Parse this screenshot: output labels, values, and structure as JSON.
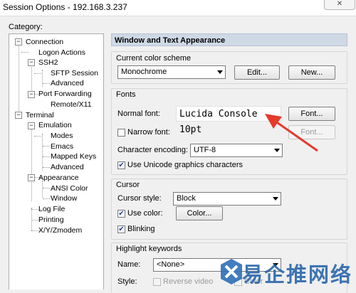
{
  "window": {
    "title": "Session Options - 192.168.3.237",
    "close_glyph": "✕"
  },
  "category_label": "Category:",
  "tree": [
    {
      "label": "Connection",
      "expander": "−"
    },
    {
      "label": "Logon Actions"
    },
    {
      "label": "SSH2",
      "expander": "−"
    },
    {
      "label": "SFTP Session"
    },
    {
      "label": "Advanced"
    },
    {
      "label": "Port Forwarding",
      "expander": "−"
    },
    {
      "label": "Remote/X11"
    },
    {
      "label": "Terminal",
      "expander": "−"
    },
    {
      "label": "Emulation",
      "expander": "−"
    },
    {
      "label": "Modes"
    },
    {
      "label": "Emacs"
    },
    {
      "label": "Mapped Keys"
    },
    {
      "label": "Advanced"
    },
    {
      "label": "Appearance",
      "expander": "−"
    },
    {
      "label": "ANSI Color"
    },
    {
      "label": "Window"
    },
    {
      "label": "Log File"
    },
    {
      "label": "Printing"
    },
    {
      "label": "X/Y/Zmodem"
    }
  ],
  "panel": {
    "header": "Window and Text Appearance",
    "color_scheme": {
      "label": "Current color scheme",
      "value": "Monochrome",
      "edit_button": "Edit...",
      "new_button": "New..."
    },
    "fonts": {
      "label": "Fonts",
      "normal_font_label": "Normal font:",
      "normal_font_value": "Lucida Console 10pt",
      "font_button": "Font...",
      "narrow_font_label": "Narrow font:",
      "narrow_font_button": "Font...",
      "encoding_label": "Character encoding:",
      "encoding_value": "UTF-8",
      "unicode_label": "Use Unicode graphics characters",
      "unicode_checked": "✔"
    },
    "cursor": {
      "label": "Cursor",
      "style_label": "Cursor style:",
      "style_value": "Block",
      "use_color_label": "Use color:",
      "use_color_checked": "✔",
      "color_button": "Color...",
      "blinking_label": "Blinking",
      "blinking_checked": "✔"
    },
    "highlight": {
      "label": "Highlight keywords",
      "name_label": "Name:",
      "name_value": "<None>",
      "style_label": "Style:",
      "reverse_video_label": "Reverse video",
      "color_label": "Color"
    }
  },
  "watermark": {
    "text": "易企推网络"
  },
  "colors": {
    "arrow": "#e33b2e",
    "header_bg": "#cfd9e6",
    "check": "#1e3f8f"
  }
}
